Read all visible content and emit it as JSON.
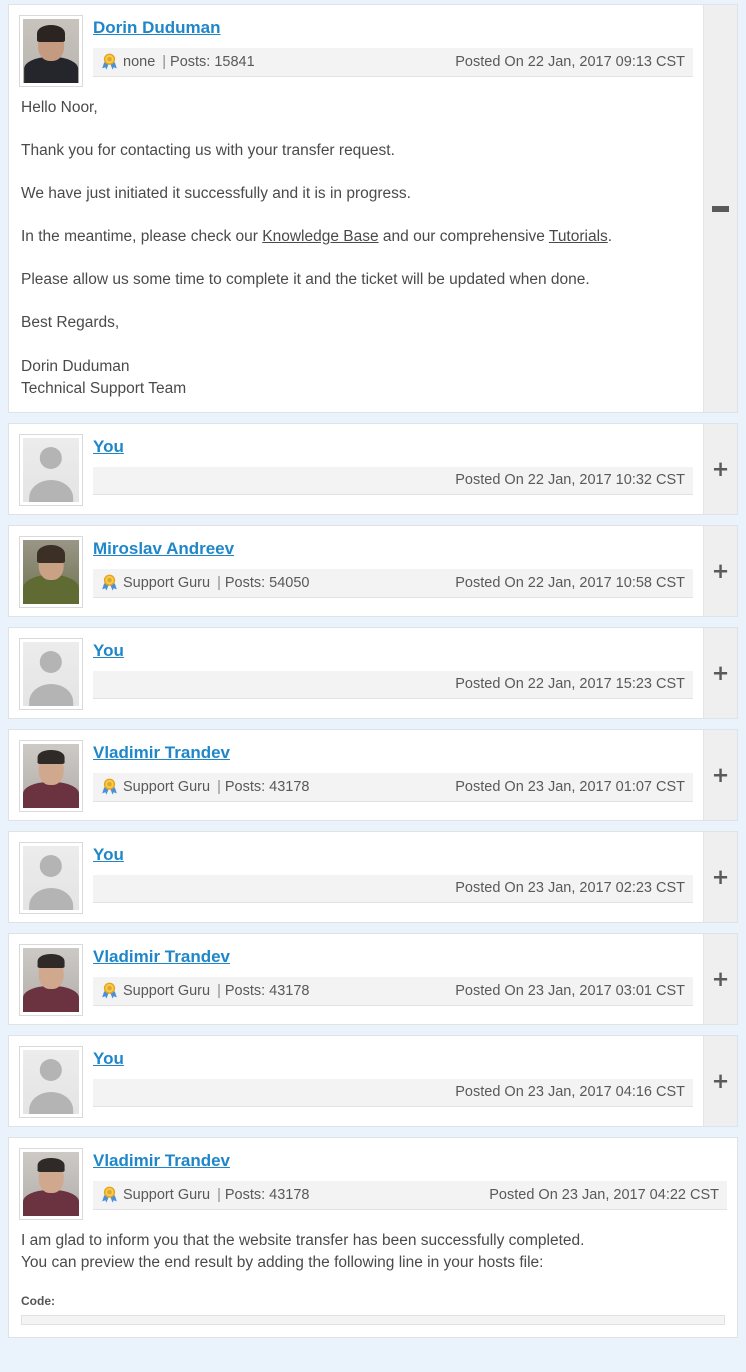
{
  "theme": {
    "page_background": "#eaf2fb",
    "post_background": "#ffffff",
    "link_color": "#1f86c9",
    "meta_bar_background": "#f3f3f3",
    "toggle_strip_background": "#efefef",
    "text_color": "#4a4a4a"
  },
  "labels": {
    "posts_prefix": "Posts:",
    "separator": "|",
    "collapse_glyph": "−",
    "expand_glyph": "+",
    "medal_icon": "medal-icon",
    "code_label": "Code:"
  },
  "posts": [
    {
      "author": "Dorin Duduman",
      "avatar": "photo-dorin",
      "rank": "none",
      "posts_count": "15841",
      "posted_on": "Posted On 22 Jan, 2017 09:13 CST",
      "expanded": true,
      "toggle": "collapse",
      "body": [
        {
          "type": "p",
          "text": "Hello Noor,"
        },
        {
          "type": "p",
          "text": "Thank you for contacting us with your transfer request."
        },
        {
          "type": "p",
          "text": "We have just initiated it successfully and it is in progress."
        },
        {
          "type": "p-links",
          "pre": "In the meantime, please check our ",
          "link1": "Knowledge Base",
          "mid": " and our comprehensive ",
          "link2": "Tutorials",
          "post": "."
        },
        {
          "type": "p",
          "text": "Please allow us some time to complete it and the ticket will be updated when done."
        },
        {
          "type": "p-tight",
          "text": "Best Regards,"
        },
        {
          "type": "p-blank",
          "text": ""
        },
        {
          "type": "p-tight",
          "text": "Dorin Duduman"
        },
        {
          "type": "p",
          "text": "Technical Support Team"
        }
      ]
    },
    {
      "author": "You",
      "avatar": "placeholder",
      "rank": "",
      "posts_count": "",
      "posted_on": "Posted On 22 Jan, 2017 10:32 CST",
      "expanded": false,
      "toggle": "expand",
      "body": []
    },
    {
      "author": "Miroslav Andreev",
      "avatar": "photo-miroslav",
      "rank": "Support Guru",
      "posts_count": "54050",
      "posted_on": "Posted On 22 Jan, 2017 10:58 CST",
      "expanded": false,
      "toggle": "expand",
      "body": []
    },
    {
      "author": "You",
      "avatar": "placeholder",
      "rank": "",
      "posts_count": "",
      "posted_on": "Posted On 22 Jan, 2017 15:23 CST",
      "expanded": false,
      "toggle": "expand",
      "body": []
    },
    {
      "author": "Vladimir Trandev",
      "avatar": "photo-vladimir",
      "rank": "Support Guru",
      "posts_count": "43178",
      "posted_on": "Posted On 23 Jan, 2017 01:07 CST",
      "expanded": false,
      "toggle": "expand",
      "body": []
    },
    {
      "author": "You",
      "avatar": "placeholder",
      "rank": "",
      "posts_count": "",
      "posted_on": "Posted On 23 Jan, 2017 02:23 CST",
      "expanded": false,
      "toggle": "expand",
      "body": []
    },
    {
      "author": "Vladimir Trandev",
      "avatar": "photo-vladimir",
      "rank": "Support Guru",
      "posts_count": "43178",
      "posted_on": "Posted On 23 Jan, 2017 03:01 CST",
      "expanded": false,
      "toggle": "expand",
      "body": []
    },
    {
      "author": "You",
      "avatar": "placeholder",
      "rank": "",
      "posts_count": "",
      "posted_on": "Posted On 23 Jan, 2017 04:16 CST",
      "expanded": false,
      "toggle": "expand",
      "body": []
    },
    {
      "author": "Vladimir Trandev",
      "avatar": "photo-vladimir",
      "rank": "Support Guru",
      "posts_count": "43178",
      "posted_on": "Posted On 23 Jan, 2017 04:22 CST",
      "expanded": true,
      "toggle": "none",
      "body": [
        {
          "type": "p-tight",
          "text": "I am glad to inform you that the website transfer has been successfully completed."
        },
        {
          "type": "p-tight",
          "text": "You can preview the end result by adding the following line in your hosts file:"
        }
      ],
      "code_label": "Code:"
    }
  ]
}
